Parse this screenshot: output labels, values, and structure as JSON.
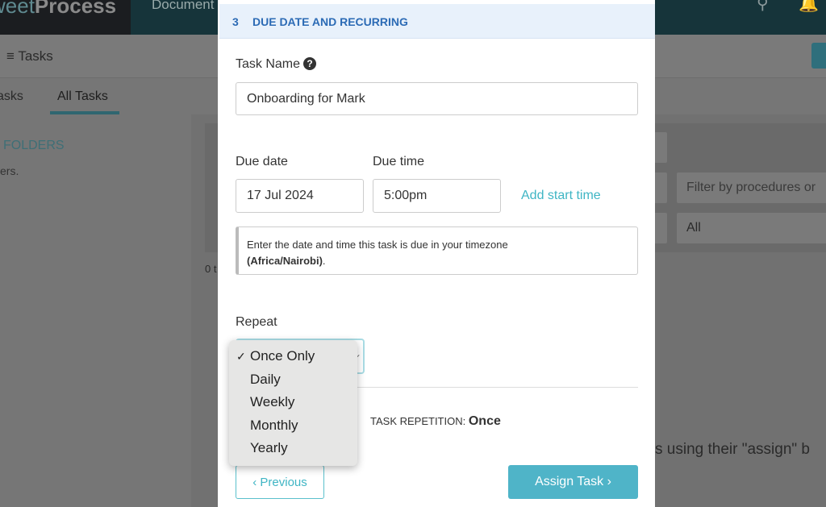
{
  "nav": {
    "logo_light": "weet",
    "logo_bold": "Process",
    "documents": "Document",
    "search_icon": "search-icon",
    "bell_icon": "bell-icon"
  },
  "page": {
    "title": "Tasks",
    "tabs": [
      {
        "label": "asks"
      },
      {
        "label": "All Tasks",
        "active": true
      }
    ],
    "folders": "FOLDERS",
    "folders_sub": "ers.",
    "filter_placeholder": "Filter by procedures or",
    "filter_all": "All",
    "count": "0 t",
    "bg_text": "s using their \"assign\" b"
  },
  "modal": {
    "step_number": "3",
    "step_title": "DUE DATE AND RECURRING",
    "task_name_label": "Task Name",
    "task_name_value": "Onboarding for Mark",
    "due_date_label": "Due date",
    "due_date_value": "17 Jul 2024",
    "due_time_label": "Due time",
    "due_time_value": "5:00pm",
    "add_start_time": "Add start time",
    "note_text": "Enter the date and time this task is due in your timezone",
    "note_tz": "(Africa/Nairobi)",
    "note_end": ".",
    "repeat_label": "Repeat",
    "repeat_options": [
      {
        "label": "Once Only",
        "selected": true
      },
      {
        "label": "Daily"
      },
      {
        "label": "Weekly"
      },
      {
        "label": "Monthly"
      },
      {
        "label": "Yearly"
      }
    ],
    "repetition_label": "TASK REPETITION:",
    "repetition_value": "Once",
    "previous": "‹ Previous",
    "assign": "Assign Task ›"
  },
  "colors": {
    "accent": "#4fb4c8",
    "header_blue": "#2c6bb5",
    "nav_dark": "#16343a"
  }
}
